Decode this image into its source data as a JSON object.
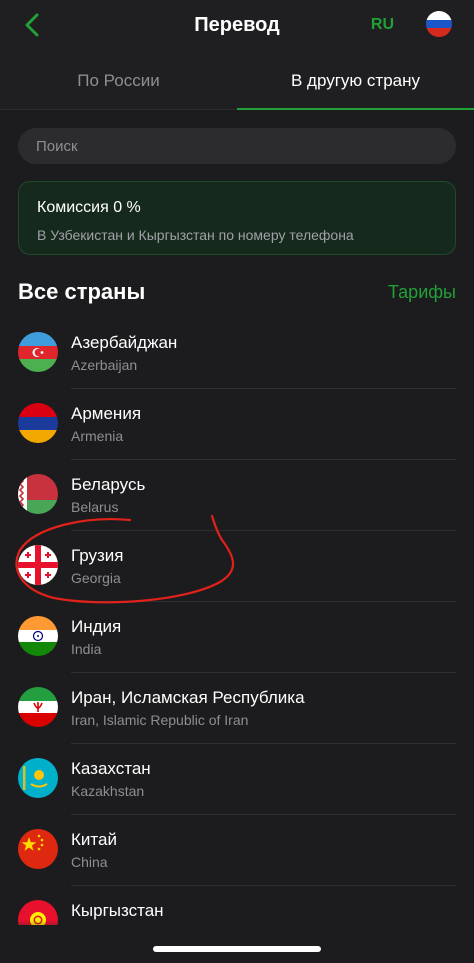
{
  "header": {
    "title": "Перевод",
    "lang": "RU"
  },
  "tabs": [
    {
      "label": "По России",
      "active": false
    },
    {
      "label": "В другую страну",
      "active": true
    }
  ],
  "search": {
    "placeholder": "Поиск"
  },
  "promo": {
    "title": "Комиссия 0 %",
    "subtitle": "В Узбекистан и Кыргызстан по номеру телефона"
  },
  "section": {
    "title": "Все страны",
    "link": "Тарифы"
  },
  "countries": [
    {
      "name": "Азербайджан",
      "name_en": "Azerbaijan",
      "flag": "azerbaijan-flag"
    },
    {
      "name": "Армения",
      "name_en": "Armenia",
      "flag": "armenia-flag"
    },
    {
      "name": "Беларусь",
      "name_en": "Belarus",
      "flag": "belarus-flag"
    },
    {
      "name": "Грузия",
      "name_en": "Georgia",
      "flag": "georgia-flag"
    },
    {
      "name": "Индия",
      "name_en": "India",
      "flag": "india-flag"
    },
    {
      "name": "Иран, Исламская Республика",
      "name_en": "Iran, Islamic Republic of Iran",
      "flag": "iran-flag"
    },
    {
      "name": "Казахстан",
      "name_en": "Kazakhstan",
      "flag": "kazakhstan-flag"
    },
    {
      "name": "Китай",
      "name_en": "China",
      "flag": "china-flag"
    },
    {
      "name": "Кыргызстан",
      "name_en": "",
      "flag": "kyrgyzstan-flag"
    }
  ],
  "colors": {
    "accent": "#21a038",
    "background": "#1c1c1e",
    "annotation": "#e0221b"
  }
}
